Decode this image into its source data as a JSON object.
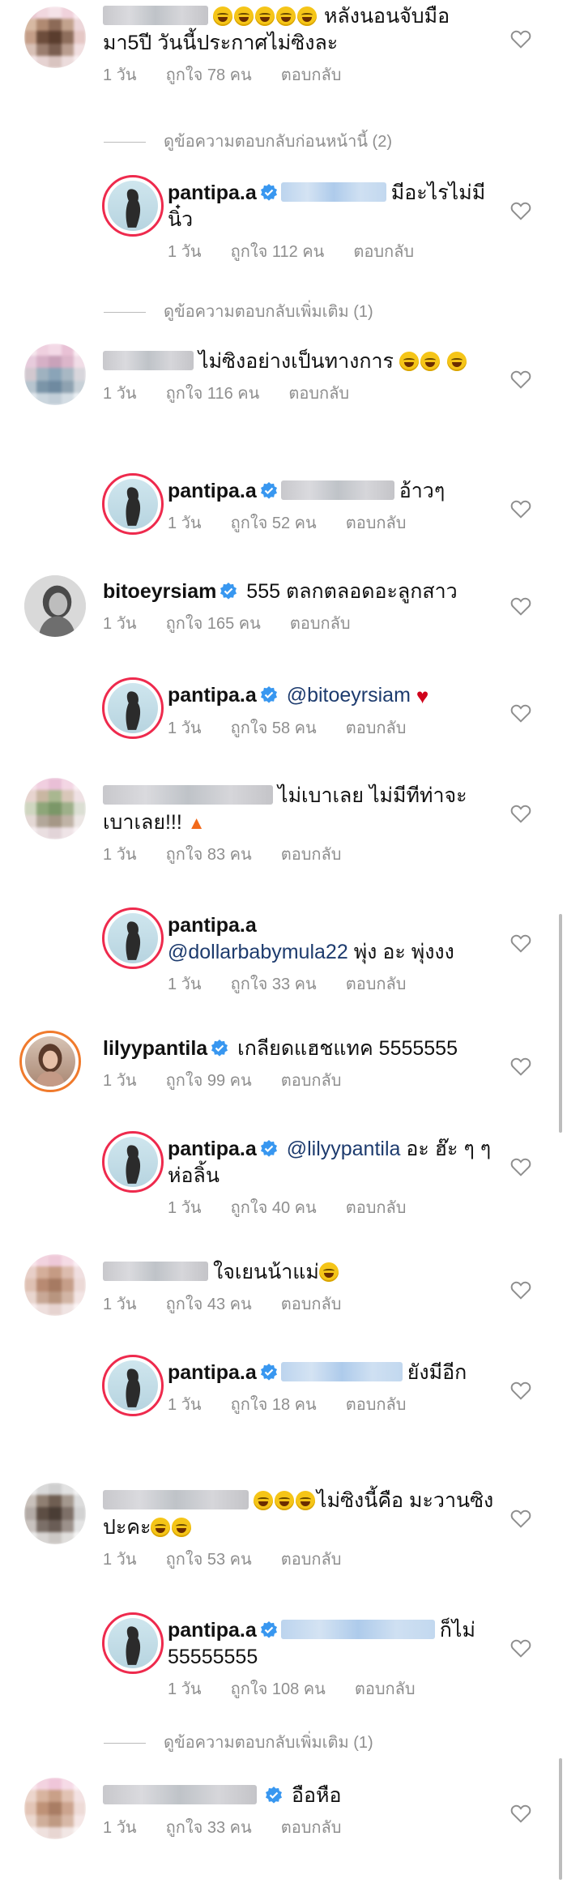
{
  "meta": {
    "time": "1 วัน",
    "reply": "ตอบกลับ"
  },
  "colors": {
    "verified": "#3897f0",
    "mention": "#1d3b6e",
    "gray_text": "#8e8e8e",
    "story_ring": "#ee2a4d"
  },
  "icons": {
    "like": "heart-outline-icon",
    "verified": "verified-badge-icon"
  },
  "comments": [
    {
      "user": "",
      "text": "หลังนอนจับมือมา5ปี วันนี้ประกาศไม่ซิงละ",
      "likes": "ถูกใจ 78 คน"
    },
    {
      "view_more": "ดูข้อความตอบกลับก่อนหน้านี้ (2)"
    },
    {
      "user": "pantipa.a",
      "text": "มีอะไรไม่มีนิ๋ว",
      "likes": "ถูกใจ 112 คน"
    },
    {
      "view_more": "ดูข้อความตอบกลับเพิ่มเติม (1)"
    },
    {
      "user": "",
      "text": "ไม่ซิงอย่างเป็นทางการ",
      "likes": "ถูกใจ 116 คน"
    },
    {
      "user": "pantipa.a",
      "text": "อ้าวๆ",
      "likes": "ถูกใจ 52 คน"
    },
    {
      "user": "bitoeyrsiam",
      "text": "555 ตลกตลอดอะลูกสาว",
      "likes": "ถูกใจ 165 คน"
    },
    {
      "user": "pantipa.a",
      "mention": "@bitoeyrsiam",
      "text": "",
      "likes": "ถูกใจ 58 คน"
    },
    {
      "user": "",
      "text": "ไม่เบาเลย ไม่มีทีท่าจะเบาเลย!!!",
      "likes": "ถูกใจ 83 คน"
    },
    {
      "user": "pantipa.a",
      "mention": "@dollarbabymula22",
      "text": "พุ่ง อะ พุ่งงง",
      "likes": "ถูกใจ 33 คน"
    },
    {
      "user": "lilyypantila",
      "text": "เกลียดแฮชแทค 5555555",
      "likes": "ถูกใจ 99 คน"
    },
    {
      "user": "pantipa.a",
      "mention": "@lilyypantila",
      "text": "อะ ฮ๊ะ ๆ ๆ ห่อลิ้น",
      "likes": "ถูกใจ 40 คน"
    },
    {
      "user": "",
      "text": "ใจเยนน้าแม่",
      "likes": "ถูกใจ 43 คน"
    },
    {
      "user": "pantipa.a",
      "text": "ยังมีอีก",
      "likes": "ถูกใจ 18 คน"
    },
    {
      "user": "",
      "text": "ไม่ซิงนี้คือ มะวานซิงปะคะ",
      "likes": "ถูกใจ 53 คน"
    },
    {
      "user": "pantipa.a",
      "text": "ก็ไม่ 55555555",
      "likes": "ถูกใจ 108 คน"
    },
    {
      "view_more": "ดูข้อความตอบกลับเพิ่มเติม (1)"
    },
    {
      "user": "",
      "text": "อือหือ",
      "likes": "ถูกใจ 33 คน"
    }
  ]
}
